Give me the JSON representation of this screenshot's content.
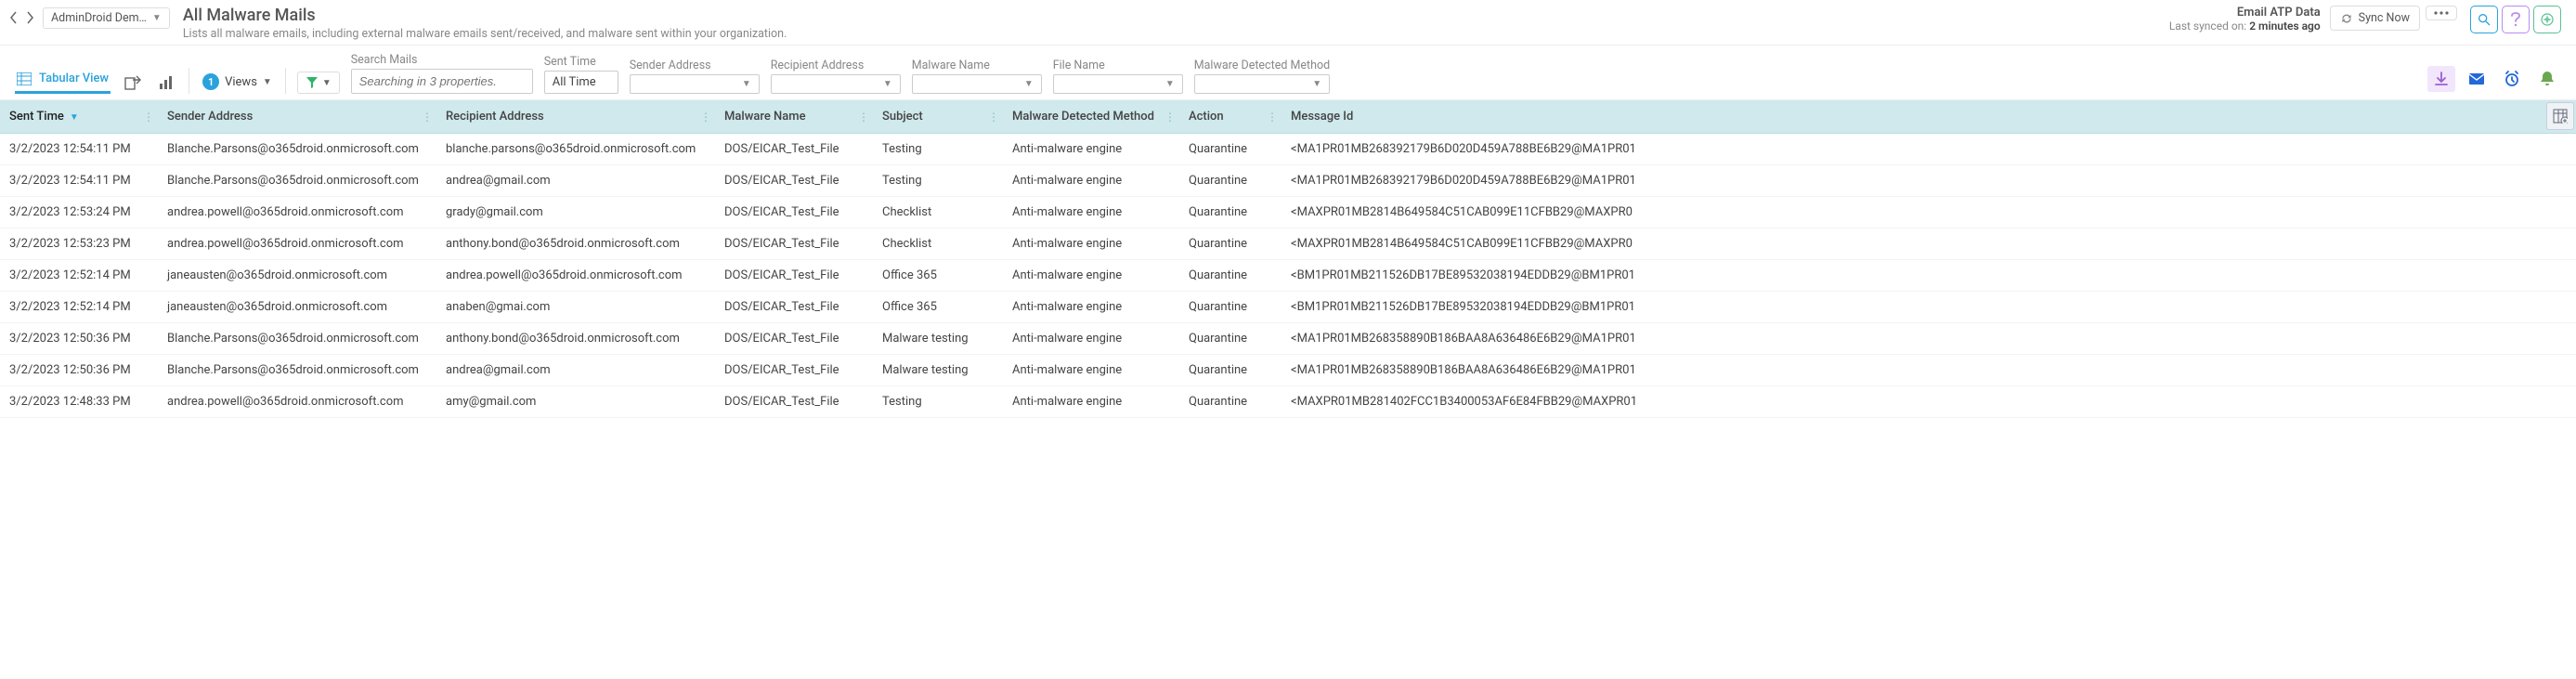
{
  "tenant": "AdminDroid Dem…",
  "page": {
    "title": "All Malware Mails",
    "subtitle": "Lists all malware emails, including external malware emails sent/received, and malware sent within your organization."
  },
  "syncPanel": {
    "title": "Email ATP Data",
    "label": "Last synced on:",
    "value": "2 minutes ago",
    "button": "Sync Now"
  },
  "toolbar": {
    "tabularView": "Tabular View",
    "viewsBadge": "1",
    "viewsLabel": "Views",
    "search": {
      "label": "Search Mails",
      "placeholder": "Searching in 3 properties."
    },
    "filters": {
      "sentTime": {
        "label": "Sent Time",
        "value": "All Time"
      },
      "senderAddress": {
        "label": "Sender Address",
        "value": ""
      },
      "recipientAddress": {
        "label": "Recipient Address",
        "value": ""
      },
      "malwareName": {
        "label": "Malware Name",
        "value": ""
      },
      "fileName": {
        "label": "File Name",
        "value": ""
      },
      "detectedMethod": {
        "label": "Malware Detected Method",
        "value": ""
      }
    }
  },
  "columns": [
    "Sent Time",
    "Sender Address",
    "Recipient Address",
    "Malware Name",
    "Subject",
    "Malware Detected Method",
    "Action",
    "Message Id"
  ],
  "rows": [
    {
      "sent": "3/2/2023 12:54:11 PM",
      "sender": "Blanche.Parsons@o365droid.onmicrosoft.com",
      "recipient": "blanche.parsons@o365droid.onmicrosoft.com",
      "malware": "DOS/EICAR_Test_File",
      "subject": "Testing",
      "method": "Anti-malware engine",
      "action": "Quarantine",
      "msgid": "<MA1PR01MB268392179B6D020D459A788BE6B29@MA1PR01"
    },
    {
      "sent": "3/2/2023 12:54:11 PM",
      "sender": "Blanche.Parsons@o365droid.onmicrosoft.com",
      "recipient": "andrea@gmail.com",
      "malware": "DOS/EICAR_Test_File",
      "subject": "Testing",
      "method": "Anti-malware engine",
      "action": "Quarantine",
      "msgid": "<MA1PR01MB268392179B6D020D459A788BE6B29@MA1PR01"
    },
    {
      "sent": "3/2/2023 12:53:24 PM",
      "sender": "andrea.powell@o365droid.onmicrosoft.com",
      "recipient": "grady@gmail.com",
      "malware": "DOS/EICAR_Test_File",
      "subject": "Checklist",
      "method": "Anti-malware engine",
      "action": "Quarantine",
      "msgid": "<MAXPR01MB2814B649584C51CAB099E11CFBB29@MAXPR0"
    },
    {
      "sent": "3/2/2023 12:53:23 PM",
      "sender": "andrea.powell@o365droid.onmicrosoft.com",
      "recipient": "anthony.bond@o365droid.onmicrosoft.com",
      "malware": "DOS/EICAR_Test_File",
      "subject": "Checklist",
      "method": "Anti-malware engine",
      "action": "Quarantine",
      "msgid": "<MAXPR01MB2814B649584C51CAB099E11CFBB29@MAXPR0"
    },
    {
      "sent": "3/2/2023 12:52:14 PM",
      "sender": "janeausten@o365droid.onmicrosoft.com",
      "recipient": "andrea.powell@o365droid.onmicrosoft.com",
      "malware": "DOS/EICAR_Test_File",
      "subject": "Office 365",
      "method": "Anti-malware engine",
      "action": "Quarantine",
      "msgid": "<BM1PR01MB211526DB17BE89532038194EDDB29@BM1PR01"
    },
    {
      "sent": "3/2/2023 12:52:14 PM",
      "sender": "janeausten@o365droid.onmicrosoft.com",
      "recipient": "anaben@gmai.com",
      "malware": "DOS/EICAR_Test_File",
      "subject": "Office 365",
      "method": "Anti-malware engine",
      "action": "Quarantine",
      "msgid": "<BM1PR01MB211526DB17BE89532038194EDDB29@BM1PR01"
    },
    {
      "sent": "3/2/2023 12:50:36 PM",
      "sender": "Blanche.Parsons@o365droid.onmicrosoft.com",
      "recipient": "anthony.bond@o365droid.onmicrosoft.com",
      "malware": "DOS/EICAR_Test_File",
      "subject": "Malware testing",
      "method": "Anti-malware engine",
      "action": "Quarantine",
      "msgid": "<MA1PR01MB268358890B186BAA8A636486E6B29@MA1PR01"
    },
    {
      "sent": "3/2/2023 12:50:36 PM",
      "sender": "Blanche.Parsons@o365droid.onmicrosoft.com",
      "recipient": "andrea@gmail.com",
      "malware": "DOS/EICAR_Test_File",
      "subject": "Malware testing",
      "method": "Anti-malware engine",
      "action": "Quarantine",
      "msgid": "<MA1PR01MB268358890B186BAA8A636486E6B29@MA1PR01"
    },
    {
      "sent": "3/2/2023 12:48:33 PM",
      "sender": "andrea.powell@o365droid.onmicrosoft.com",
      "recipient": "amy@gmail.com",
      "malware": "DOS/EICAR_Test_File",
      "subject": "Testing",
      "method": "Anti-malware engine",
      "action": "Quarantine",
      "msgid": "<MAXPR01MB281402FCC1B3400053AF6E84FBB29@MAXPR01"
    }
  ]
}
